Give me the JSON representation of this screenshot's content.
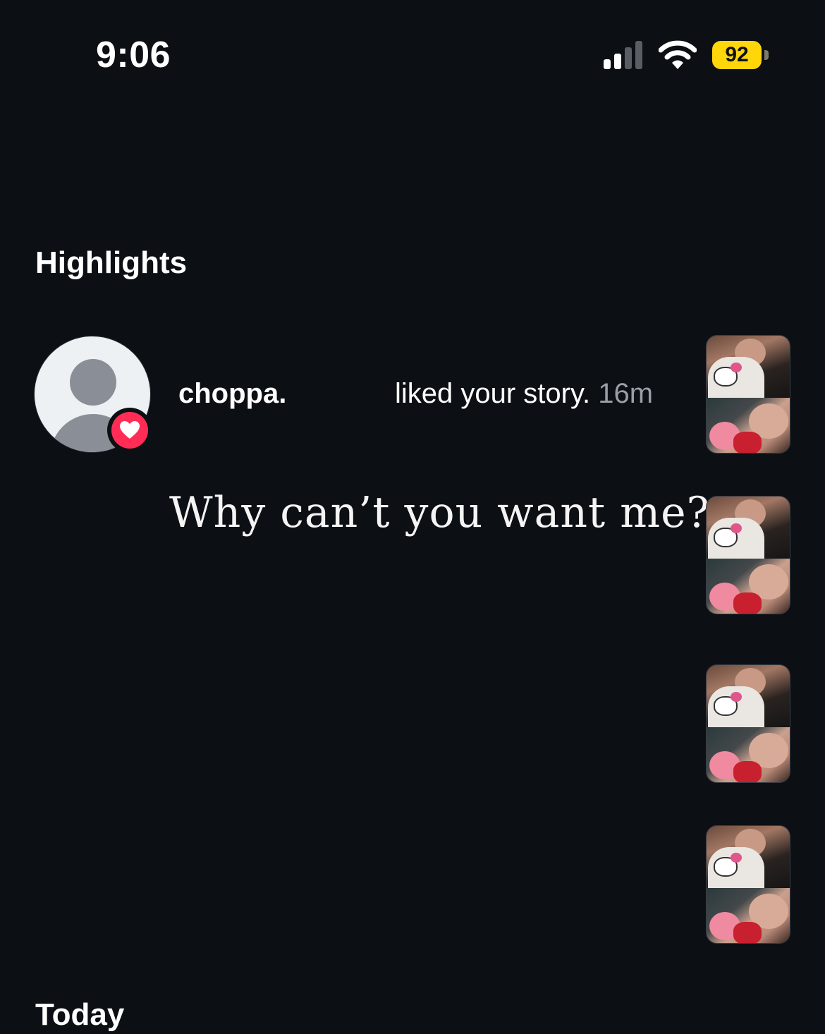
{
  "status_bar": {
    "time": "9:06",
    "battery": "92",
    "signal_icon": "cellular-signal-icon",
    "wifi_icon": "wifi-icon",
    "battery_color": "#ffd60a"
  },
  "sections": {
    "highlights_title": "Highlights",
    "today_title": "Today"
  },
  "notification": {
    "username": "choppa.",
    "action": "liked your story.",
    "time": "16m",
    "avatar_icon": "default-avatar-icon",
    "badge_icon": "heart-icon",
    "badge_color": "#ff2d55"
  },
  "overlay_text": "Why can’t you want me?",
  "story_thumbnails_count": 4
}
